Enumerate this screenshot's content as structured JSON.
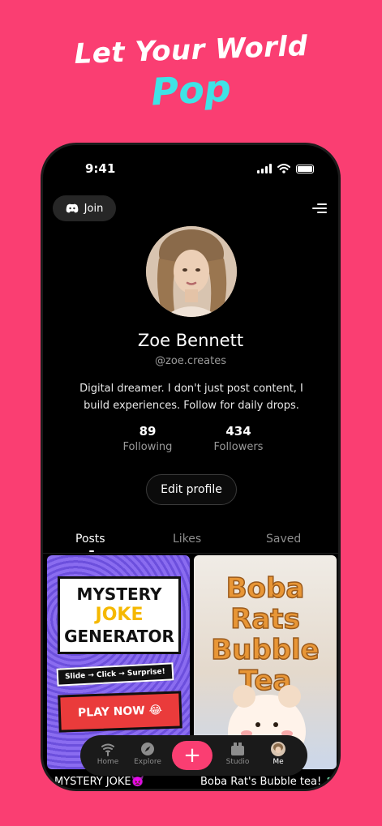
{
  "headline": {
    "line1": "Let Your World",
    "line2": "Pop"
  },
  "status_bar": {
    "time": "9:41"
  },
  "header": {
    "join_label": "Join"
  },
  "profile": {
    "name": "Zoe Bennett",
    "handle": "@zoe.creates",
    "bio": "Digital dreamer. I don't just post content, I build experiences. Follow for daily drops.",
    "following_count": "89",
    "following_label": "Following",
    "followers_count": "434",
    "followers_label": "Followers",
    "edit_label": "Edit profile"
  },
  "tabs": [
    {
      "label": "Posts",
      "active": true
    },
    {
      "label": "Likes",
      "active": false
    },
    {
      "label": "Saved",
      "active": false
    }
  ],
  "posts": [
    {
      "thumb_line1": "MYSTERY",
      "thumb_line2": "JOKE",
      "thumb_line3": "GENERATOR",
      "thumb_slide": "Slide → Click → Surprise!",
      "thumb_play": "PLAY NOW 😂",
      "caption": "MYSTERY JOKE👿"
    },
    {
      "thumb_line1": "Boba",
      "thumb_line2": "Rats",
      "thumb_line3": "Bubble",
      "thumb_line4": "Tea",
      "caption": "Boba Rat's Bubble tea! 🧋"
    }
  ],
  "nav": {
    "home": "Home",
    "explore": "Explore",
    "create": "+",
    "studio": "Studio",
    "me": "Me"
  },
  "colors": {
    "background": "#fa3e72",
    "accent_cyan": "#3fe3e6",
    "phone": "#000000"
  }
}
